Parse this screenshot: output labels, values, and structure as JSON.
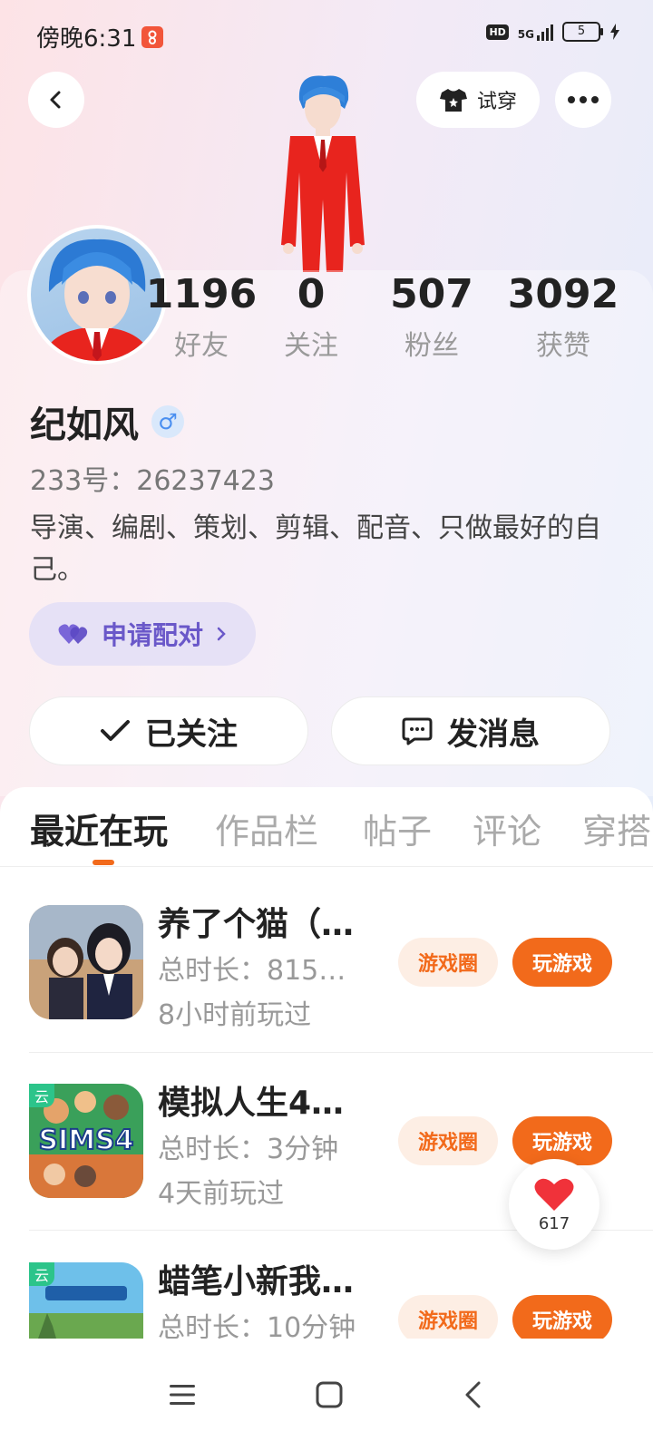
{
  "status_bar": {
    "time": "傍晚6:31",
    "network": "5G",
    "hd": "HD",
    "battery": "5"
  },
  "header": {
    "try_on_label": "试穿"
  },
  "profile": {
    "stats": [
      {
        "value": "1196",
        "label": "好友"
      },
      {
        "value": "0",
        "label": "关注"
      },
      {
        "value": "507",
        "label": "粉丝"
      },
      {
        "value": "3092",
        "label": "获赞"
      }
    ],
    "name": "纪如风",
    "gender_symbol": "♂",
    "uid": "233号：26237423",
    "bio": "导演、编剧、策划、剪辑、配音、只做最好的自己。",
    "match_label": "申请配对",
    "followed_label": "已关注",
    "message_label": "发消息"
  },
  "tabs": [
    "最近在玩",
    "作品栏",
    "帖子",
    "评论",
    "穿搭"
  ],
  "games": [
    {
      "title": "养了个猫（…",
      "duration": "总时长：815…",
      "last_played": "8小时前玩过",
      "circle_label": "游戏圈",
      "play_label": "玩游戏",
      "cloud": ""
    },
    {
      "title": "模拟人生4…",
      "duration": "总时长：3分钟",
      "last_played": "4天前玩过",
      "circle_label": "游戏圈",
      "play_label": "玩游戏",
      "cloud": "云"
    },
    {
      "title": "蜡笔小新我…",
      "duration": "总时长：10分钟",
      "last_played": "",
      "circle_label": "游戏圈",
      "play_label": "玩游戏",
      "cloud": "云"
    }
  ],
  "like_count": "617",
  "colors": {
    "accent": "#f26a1b",
    "match_purple": "#6a58c9"
  }
}
